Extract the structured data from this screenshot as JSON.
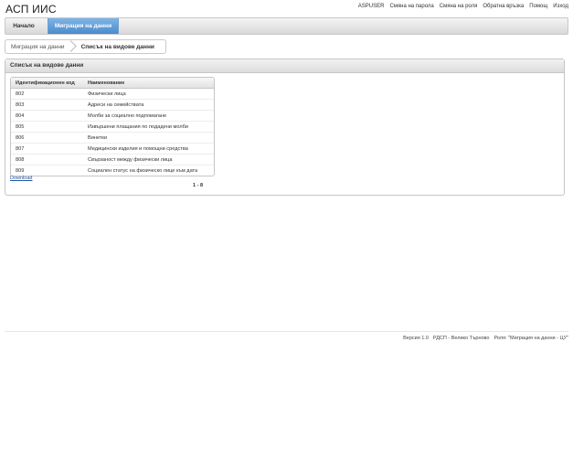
{
  "app": {
    "title": "АСП ИИС"
  },
  "top_links": [
    "ASPUSER",
    "Смяна на парола",
    "Смяна на роля",
    "Обратна връзка",
    "Помощ",
    "Изход"
  ],
  "nav": {
    "home": "Начало",
    "migration": "Миграция на данни"
  },
  "breadcrumb": {
    "parent": "Миграция на данни",
    "current": "Списък на видове данни"
  },
  "panel": {
    "title": "Списък на видове данни"
  },
  "table": {
    "headers": [
      "Идентификационен код",
      "Наименование"
    ],
    "rows": [
      [
        "802",
        "Физически лица"
      ],
      [
        "803",
        "Адреси на семействата"
      ],
      [
        "804",
        "Молби за социално подпомагане"
      ],
      [
        "805",
        "Извършени плащания по подадени молби"
      ],
      [
        "806",
        "Винетки"
      ],
      [
        "807",
        "Медицински изделия и помощни средства"
      ],
      [
        "808",
        "Свързаност между физически лица"
      ],
      [
        "809",
        "Социален статус на физическо лице към дата"
      ]
    ]
  },
  "download_label": "Download",
  "pager": "1 - 8",
  "footer": {
    "version": "Версия 1.0",
    "office": "РДСП - Велико Търново",
    "role": "Роля: \"Миграция на данни - ЦУ\""
  }
}
